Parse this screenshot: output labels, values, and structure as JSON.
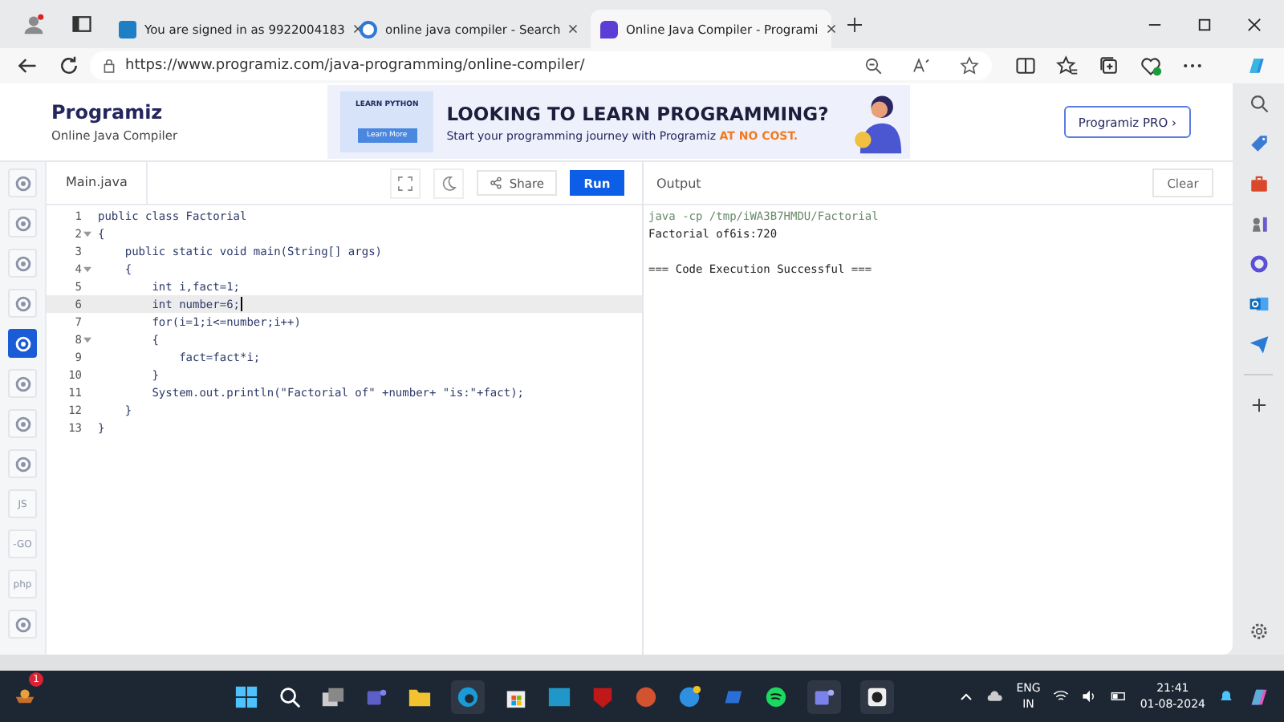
{
  "browser": {
    "tabs": [
      {
        "title": "You are signed in as 9922004183",
        "selected": false
      },
      {
        "title": "online java compiler - Search",
        "selected": false
      },
      {
        "title": "Online Java Compiler - Programi",
        "selected": true
      }
    ],
    "address": "https://www.programiz.com/java-programming/online-compiler/"
  },
  "header": {
    "logo": "Programiz",
    "subtitle": "Online Java Compiler",
    "banner": {
      "badge_top": "LEARN PYTHON",
      "badge_button": "Learn More",
      "headline": "LOOKING TO LEARN PROGRAMMING?",
      "tagline": "Start your programming journey with Programiz ",
      "tagline_accent": "AT NO COST."
    },
    "pro_button": "Programiz PRO ›"
  },
  "languages": [
    {
      "kind": "icon",
      "selected": false
    },
    {
      "kind": "icon",
      "selected": false
    },
    {
      "kind": "icon",
      "selected": false
    },
    {
      "kind": "icon",
      "selected": false
    },
    {
      "kind": "icon",
      "selected": true
    },
    {
      "kind": "icon",
      "selected": false
    },
    {
      "kind": "icon",
      "selected": false
    },
    {
      "kind": "icon",
      "selected": false
    },
    {
      "kind": "text",
      "label": "JS",
      "selected": false
    },
    {
      "kind": "text",
      "label": "-GO",
      "selected": false
    },
    {
      "kind": "text",
      "label": "php",
      "selected": false
    },
    {
      "kind": "icon",
      "selected": false
    }
  ],
  "editor": {
    "file": "Main.java",
    "share": "Share",
    "run": "Run",
    "lines": [
      {
        "number": "1",
        "code": "public class Factorial",
        "foldable": false,
        "selected": false
      },
      {
        "number": "2",
        "code": "{",
        "foldable": true,
        "selected": false
      },
      {
        "number": "3",
        "code": "    public static void main(String[] args)",
        "foldable": false,
        "selected": false
      },
      {
        "number": "4",
        "code": "    {",
        "foldable": true,
        "selected": false
      },
      {
        "number": "5",
        "code": "        int i,fact=1;",
        "foldable": false,
        "selected": false
      },
      {
        "number": "6",
        "code": "        int number=6;",
        "foldable": false,
        "selected": true
      },
      {
        "number": "7",
        "code": "        for(i=1;i<=number;i++)",
        "foldable": false,
        "selected": false
      },
      {
        "number": "8",
        "code": "        {",
        "foldable": true,
        "selected": false
      },
      {
        "number": "9",
        "code": "            fact=fact*i;",
        "foldable": false,
        "selected": false
      },
      {
        "number": "10",
        "code": "        }",
        "foldable": false,
        "selected": false
      },
      {
        "number": "11",
        "code": "        System.out.println(\"Factorial of\" +number+ \"is:\"+fact);",
        "foldable": false,
        "selected": false
      },
      {
        "number": "12",
        "code": "    }",
        "foldable": false,
        "selected": false
      },
      {
        "number": "13",
        "code": "}",
        "foldable": false,
        "selected": false
      }
    ]
  },
  "output": {
    "title": "Output",
    "clear": "Clear",
    "lines": [
      {
        "kind": "command",
        "text": "java -cp /tmp/iWA3B7HMDU/Factorial"
      },
      {
        "kind": "stdout",
        "text": "Factorial of6is:720"
      },
      {
        "kind": "blank"
      },
      {
        "kind": "stdout",
        "text": "=== Code Execution Successful ==="
      }
    ]
  },
  "taskbar": {
    "notification_badge": "1",
    "language": "ENG",
    "region": "IN",
    "time": "21:41",
    "date": "01-08-2024"
  }
}
